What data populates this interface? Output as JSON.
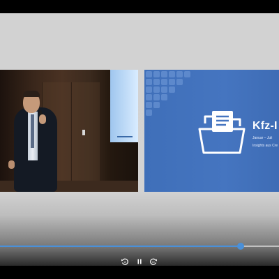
{
  "slide": {
    "title": "Kfz-I",
    "date": "Januar – Juli",
    "subtitle": "Insights aus Cre"
  },
  "player": {
    "progress_fraction": 0.8625,
    "accent_color": "#4a90d9"
  },
  "controls": {
    "rewind_icon": "rewind-10-icon",
    "pause_icon": "pause-icon",
    "forward_icon": "forward-10-icon"
  }
}
